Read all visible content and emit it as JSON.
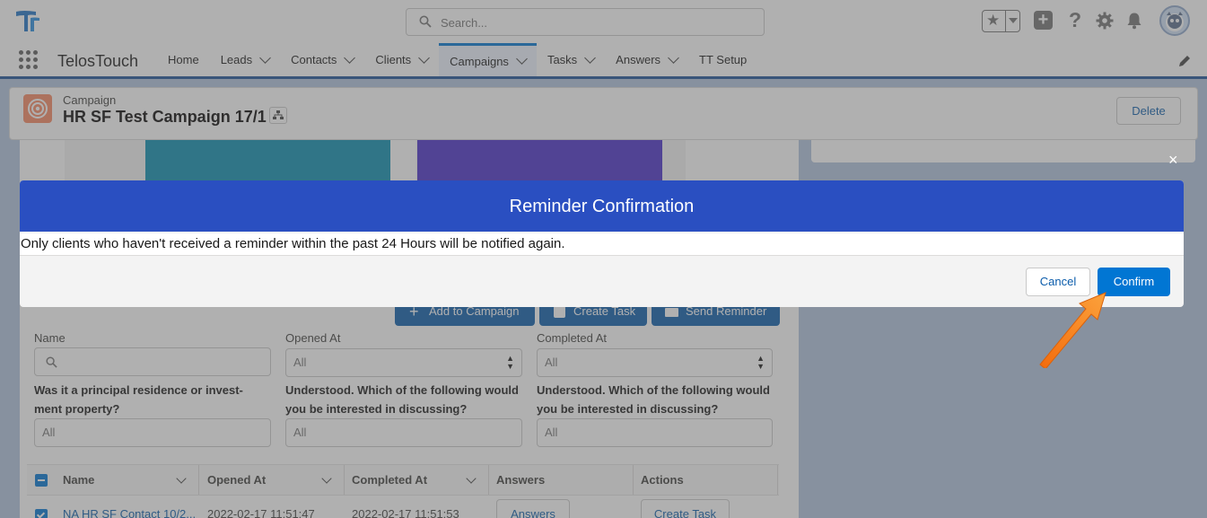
{
  "header": {
    "search_placeholder": "Search..."
  },
  "nav": {
    "app_name": "TelosTouch",
    "items": [
      {
        "label": "Home",
        "dropdown": false,
        "active": false
      },
      {
        "label": "Leads",
        "dropdown": true,
        "active": false
      },
      {
        "label": "Contacts",
        "dropdown": true,
        "active": false
      },
      {
        "label": "Clients",
        "dropdown": true,
        "active": false
      },
      {
        "label": "Campaigns",
        "dropdown": true,
        "active": true
      },
      {
        "label": "Tasks",
        "dropdown": true,
        "active": false
      },
      {
        "label": "Answers",
        "dropdown": true,
        "active": false
      },
      {
        "label": "TT Setup",
        "dropdown": false,
        "active": false
      }
    ]
  },
  "record": {
    "type_label": "Campaign",
    "name": "HR SF Test Campaign 17/1",
    "delete_label": "Delete"
  },
  "actions": {
    "add_to_campaign": "Add to Campaign",
    "create_task": "Create Task",
    "send_reminder": "Send Reminder"
  },
  "filters": {
    "name_label": "Name",
    "opened_at_label": "Opened At",
    "opened_at_value": "All",
    "completed_at_label": "Completed At",
    "completed_at_value": "All",
    "q1_label": "Was it a principal residence or invest-ment property?",
    "q1_value": "All",
    "q2_label": "Understood. Which of the following would you be interested in discussing?",
    "q2_value": "All",
    "q3_label": "Understood. Which of the following would you be interested in discussing?",
    "q3_value": "All"
  },
  "table": {
    "columns": [
      "Name",
      "Opened At",
      "Completed At",
      "Answers",
      "Actions"
    ],
    "rows": [
      {
        "name": "NA HR SF Contact 10/2...",
        "opened_at": "2022-02-17 11:51:47",
        "completed_at": "2022-02-17 11:51:53",
        "answers_button": "Answers",
        "action_button": "Create Task"
      }
    ]
  },
  "modal": {
    "title": "Reminder Confirmation",
    "message": "Only clients who haven't received a reminder within the past 24 Hours will be notified again.",
    "cancel_label": "Cancel",
    "confirm_label": "Confirm",
    "close_symbol": "×"
  },
  "colors": {
    "modal_header": "#2a4fc1",
    "confirm_button": "#0176d3",
    "arrow": "#f5821f",
    "nav_border": "#1b5297"
  }
}
